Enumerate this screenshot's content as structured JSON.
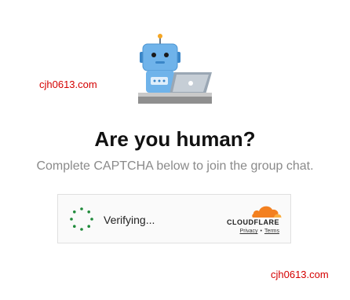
{
  "watermarks": {
    "top": "cjh0613.com",
    "bottom": "cjh0613.com"
  },
  "illustration": {
    "icon": "robot-with-laptop-icon"
  },
  "heading": {
    "title": "Are you human?",
    "subtitle": "Complete CAPTCHA below to join the group chat."
  },
  "captcha": {
    "status": "Verifying...",
    "spinner_icon": "loading-spinner-icon",
    "brand": "CLOUDFLARE",
    "brand_icon": "cloudflare-cloud-icon",
    "privacy_label": "Privacy",
    "separator": "•",
    "terms_label": "Terms",
    "colors": {
      "spinner": "#1f8a3a",
      "brand_orange": "#f38020",
      "brand_light": "#faae40"
    }
  }
}
